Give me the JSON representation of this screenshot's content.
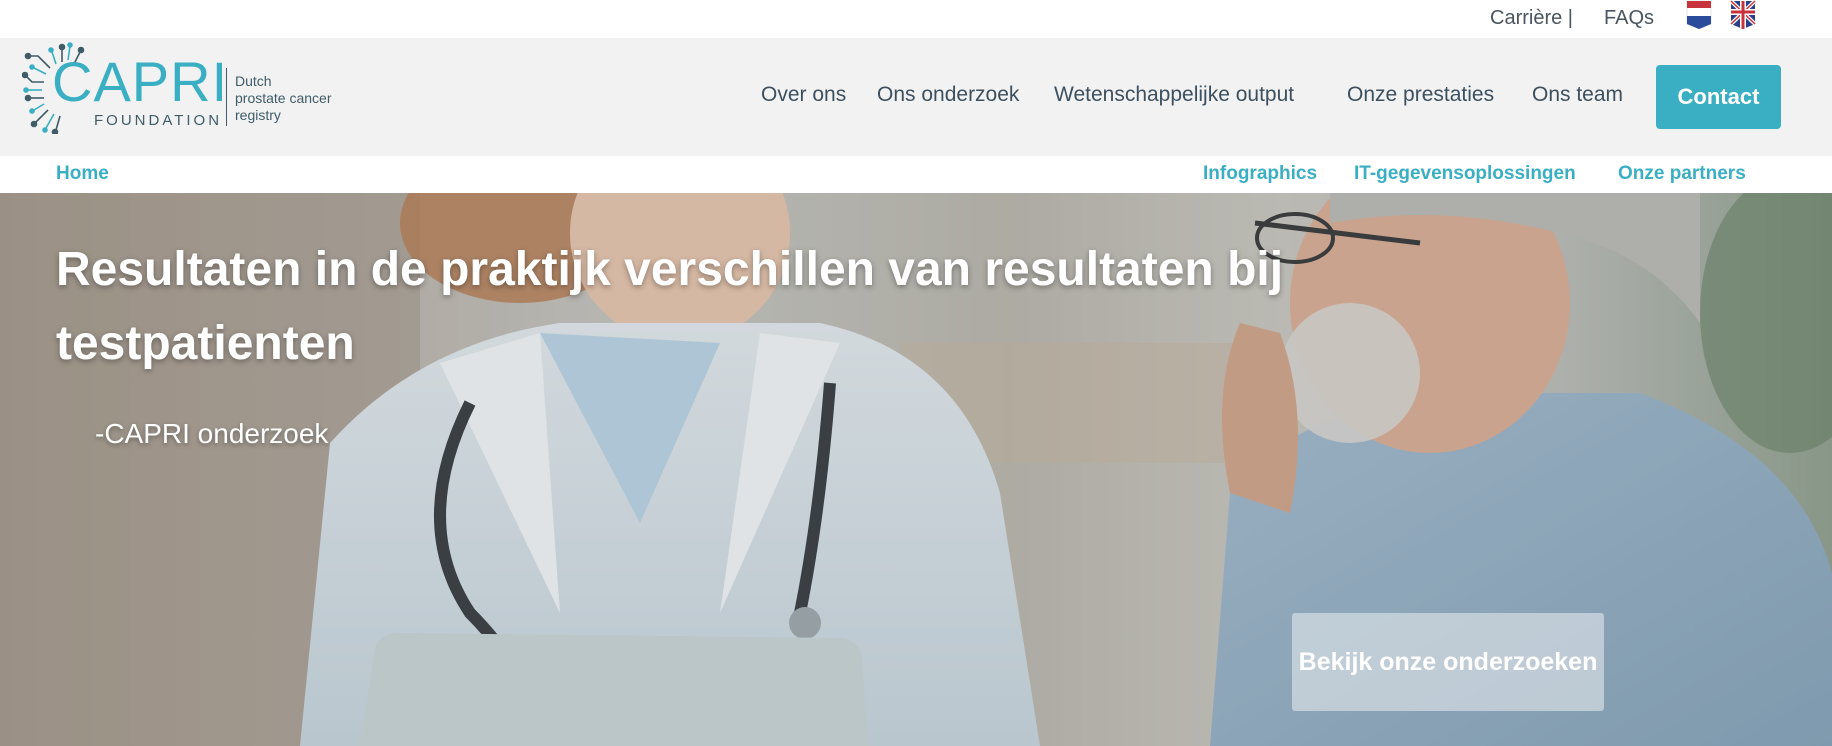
{
  "topbar": {
    "career_label": "Carrière |",
    "faqs_label": "FAQs",
    "languages": [
      {
        "code": "nl",
        "icon": "netherlands-flag-icon"
      },
      {
        "code": "en",
        "icon": "uk-flag-icon"
      }
    ]
  },
  "header": {
    "logo": {
      "name": "CAPRI",
      "sub": "FOUNDATION",
      "tagline": [
        "Dutch",
        "prostate cancer",
        "registry"
      ]
    },
    "nav": [
      "Over ons",
      "Ons onderzoek",
      "Wetenschappelijke output",
      "Onze prestaties",
      "Ons team"
    ],
    "contact_label": "Contact"
  },
  "subnav": {
    "home_label": "Home",
    "items": [
      "Infographics",
      "IT-gegevensoplossingen",
      "Onze partners"
    ]
  },
  "hero": {
    "title": "Resultaten in de praktijk verschillen van resultaten bij testpatienten",
    "attribution": "-CAPRI onderzoek",
    "cta_label": "Bekijk onze onderzoeken"
  },
  "colors": {
    "accent": "#3aafc4",
    "nav_text": "#3c5060",
    "header_bg": "#f2f2f2"
  }
}
